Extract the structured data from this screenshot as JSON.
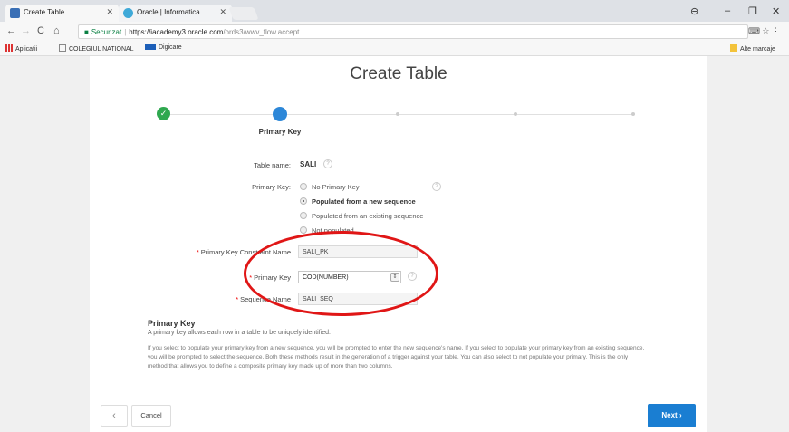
{
  "colors": {
    "accent": "#1a7ed2",
    "done": "#2fa84f",
    "annotation": "#e01616"
  },
  "browser": {
    "tabs": [
      {
        "title": "Create Table",
        "icon": "apex-tab-icon"
      },
      {
        "title": "Oracle | Informatica",
        "icon": "oracle-tab-icon"
      }
    ],
    "secure_label": "Securizat",
    "url_host": "https://iacademy3.oracle.com",
    "url_path": "/ords3/wwv_flow.accept",
    "bookmarks": [
      "Aplicații",
      "COLEGIUL NATIONAL",
      "Digicare"
    ],
    "other_bookmarks": "Alte marcaje"
  },
  "page": {
    "title": "Create Table",
    "wizard": {
      "current_step": "Primary Key"
    },
    "form": {
      "table_name_label": "Table name:",
      "table_name_value": "SALI",
      "primary_key_label": "Primary Key:",
      "options": [
        "No Primary Key",
        "Populated from a new sequence",
        "Populated from an existing sequence",
        "Not populated"
      ],
      "selected_option": "Populated from a new sequence",
      "constraint_label": "Primary Key Constraint Name",
      "constraint_value": "SALI_PK",
      "pk_column_label": "Primary Key",
      "pk_column_value": "COD(NUMBER)",
      "sequence_label": "Sequence Name",
      "sequence_value": "SALI_SEQ"
    },
    "help": {
      "heading": "Primary Key",
      "subtitle": "A primary key allows each row in a table to be uniquely identified.",
      "description": "If you select to populate your primary key from a new sequence, you will be prompted to enter the new sequence's name. If you select to populate your primary key from an existing sequence, you will be prompted to select the sequence. Both these methods result in the generation of a trigger against your table. You can also select to not populate your primary. This is the only method that allows you to define a composite primary key made up of more than two columns."
    },
    "buttons": {
      "back": "‹",
      "cancel": "Cancel",
      "next": "Next ›"
    }
  }
}
